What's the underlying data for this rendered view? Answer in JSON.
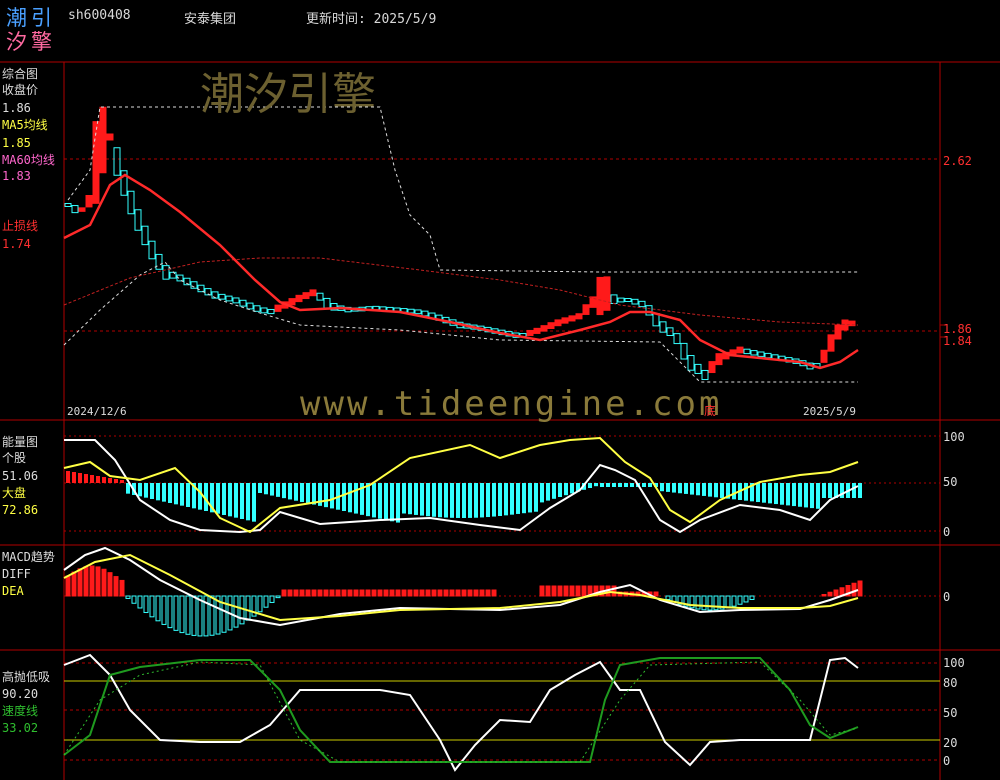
{
  "header": {
    "logo_top": "潮引",
    "logo_bottom": "汐擎",
    "code": "sh600408",
    "name": "安泰集团",
    "update_label": "更新时间: 2025/5/9"
  },
  "watermark": {
    "brand": "潮汐引擎",
    "url": "www.tideengine.com"
  },
  "colors": {
    "up": "#ff1a1a",
    "down": "#33ffff",
    "ma5": "#ffffff",
    "ma60": "#ff2a2a",
    "grid": "#b00000",
    "yellow": "#ffff44",
    "green": "#1f9a1f"
  },
  "panel_main": {
    "title": "综合图",
    "close_label": "收盘价",
    "close_value": "1.86",
    "ma5_label": "MA5均线",
    "ma5_value": "1.85",
    "ma60_label": "MA60均线",
    "ma60_value": "1.83",
    "stop_label": "止损线",
    "stop_value": "1.74",
    "right_axis": [
      "2.62",
      "1.86",
      "1.84"
    ],
    "start_date": "2024/12/6",
    "end_date": "2025/5/9",
    "bottom_marker": "底"
  },
  "panel_energy": {
    "title": "能量图",
    "stock_label": "个股",
    "stock_value": "51.06",
    "market_label": "大盘",
    "market_value": "72.86",
    "right_axis": [
      "100",
      "50",
      "0"
    ]
  },
  "panel_macd": {
    "title": "MACD趋势",
    "diff_label": "DIFF",
    "dea_label": "DEA",
    "right_axis": [
      "0"
    ]
  },
  "panel_osc": {
    "title": "高抛低吸",
    "value": "90.20",
    "speed_label": "速度线",
    "speed_value": "33.02",
    "right_axis": [
      "100",
      "80",
      "50",
      "20",
      "0"
    ]
  }
}
